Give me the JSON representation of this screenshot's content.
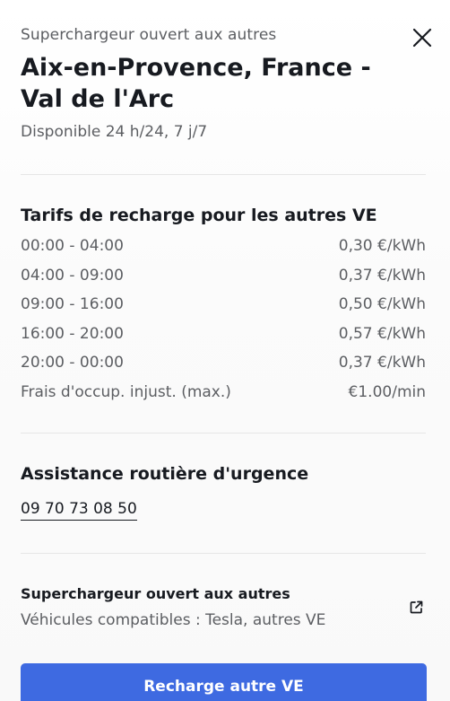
{
  "header": {
    "subtitle": "Superchargeur ouvert aux autres",
    "title": "Aix-en-Provence, France - Val de l'Arc",
    "availability": "Disponible 24 h/24, 7 j/7"
  },
  "rates": {
    "title": "Tarifs de recharge pour les autres VE",
    "rows": [
      {
        "label": "00:00 - 04:00",
        "value": "0,30 €/kWh"
      },
      {
        "label": "04:00 - 09:00",
        "value": "0,37 €/kWh"
      },
      {
        "label": "09:00 - 16:00",
        "value": "0,50 €/kWh"
      },
      {
        "label": "16:00 - 20:00",
        "value": "0,57 €/kWh"
      },
      {
        "label": "20:00 - 00:00",
        "value": "0,37 €/kWh"
      },
      {
        "label": "Frais d'occup. injust. (max.)",
        "value": "€1.00/min"
      }
    ]
  },
  "assistance": {
    "title": "Assistance routière d'urgence",
    "phone": "09 70 73 08 50"
  },
  "compatibility": {
    "title": "Superchargeur ouvert aux autres",
    "text": "Véhicules compatibles : Tesla, autres VE"
  },
  "cta": {
    "label": "Recharge autre VE"
  },
  "icons": {
    "close": "close-icon",
    "external": "external-link-icon"
  },
  "colors": {
    "accent": "#3e6ae1",
    "text_primary": "#171a20",
    "text_secondary": "#5c5e62"
  }
}
